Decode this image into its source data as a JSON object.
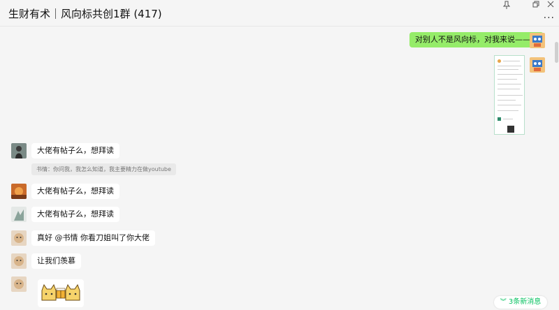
{
  "window": {
    "title": "生财有术｜风向标共创1群 (417)",
    "pin_icon": "pin-icon",
    "restore_icon": "restore-icon",
    "close_icon": "close-icon",
    "more_label": "···"
  },
  "messages": [
    {
      "sender": "me",
      "type": "text",
      "text": "对别人不是风向标，对我来说——是"
    },
    {
      "sender": "me",
      "type": "image"
    },
    {
      "sender": "other",
      "type": "text",
      "text": "大佬有帖子么，想拜读",
      "quote": "书情：你问我，我怎么知道，我主要精力在做youtube"
    },
    {
      "sender": "other",
      "type": "text",
      "text": "大佬有帖子么，想拜读"
    },
    {
      "sender": "other",
      "type": "text",
      "text": "大佬有帖子么，想拜读"
    },
    {
      "sender": "other",
      "type": "text",
      "text": "真好 @书情 你看刀姐叫了你大佬"
    },
    {
      "sender": "other",
      "type": "text",
      "text": "让我们羡慕"
    },
    {
      "sender": "other",
      "type": "sticker",
      "sticker": "cheers-cat-sticker"
    }
  ],
  "new_messages": {
    "label": "3条新消息",
    "icon": "chevron-down-icon"
  },
  "colors": {
    "my_bubble": "#95ec69",
    "other_bubble": "#ffffff",
    "accent": "#07c160"
  }
}
